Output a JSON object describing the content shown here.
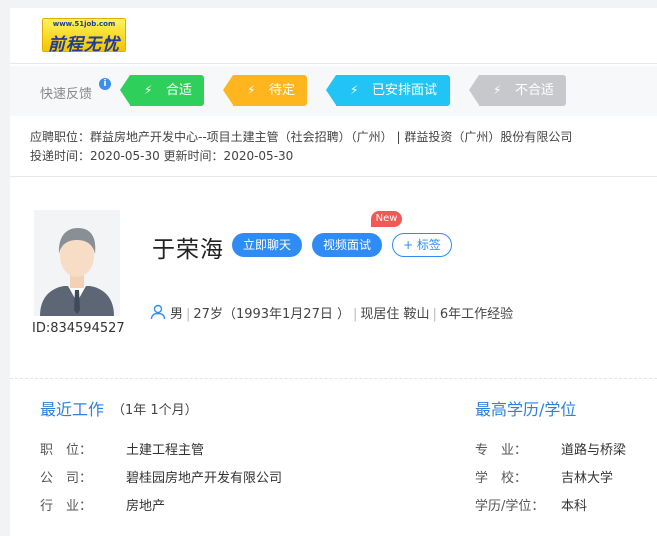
{
  "header": {
    "logo_url": "www.51job.com",
    "logo_name": "前程无忧"
  },
  "feedback": {
    "label": "快速反馈",
    "info": "i",
    "buttons": [
      {
        "label": "合适",
        "color": "#2ed05b"
      },
      {
        "label": "待定",
        "color": "#ffb61e"
      },
      {
        "label": "已安排面试",
        "color": "#22c3f5"
      },
      {
        "label": "不合适",
        "color": "#c6c8cc"
      }
    ]
  },
  "position": {
    "line1": "应聘职位：群益房地产开发中心--项目土建主管（社会招聘）（广州）   |   群益投资（广州）股份有限公司",
    "line2": "投递时间：2020-05-30    更新时间：2020-05-30"
  },
  "profile": {
    "id": "ID:834594527",
    "name": "于荣海",
    "chat_label": "立即聊天",
    "video_label": "视频面试",
    "new_badge": "New",
    "tag_label": "+ 标签",
    "gender": "男",
    "age": "27岁（1993年1月27日 ）",
    "residence": "现居住 鞍山",
    "experience": "6年工作经验"
  },
  "recent_work": {
    "title": "最近工作",
    "duration": "（1年 1个月）",
    "rows": [
      {
        "label": "职　位：",
        "value": "土建工程主管"
      },
      {
        "label": "公　司：",
        "value": "碧桂园房地产开发有限公司"
      },
      {
        "label": "行　业：",
        "value": "房地产"
      }
    ]
  },
  "education": {
    "title": "最高学历/学位",
    "rows": [
      {
        "label": "专　业：",
        "value": "道路与桥梁"
      },
      {
        "label": "学　校：",
        "value": "吉林大学"
      },
      {
        "label": "学历/学位：",
        "value": "本科"
      }
    ]
  },
  "colors": {
    "accent": "#2f8cf5",
    "section_title": "#2f7fe0",
    "new_badge": "#f05a54"
  }
}
